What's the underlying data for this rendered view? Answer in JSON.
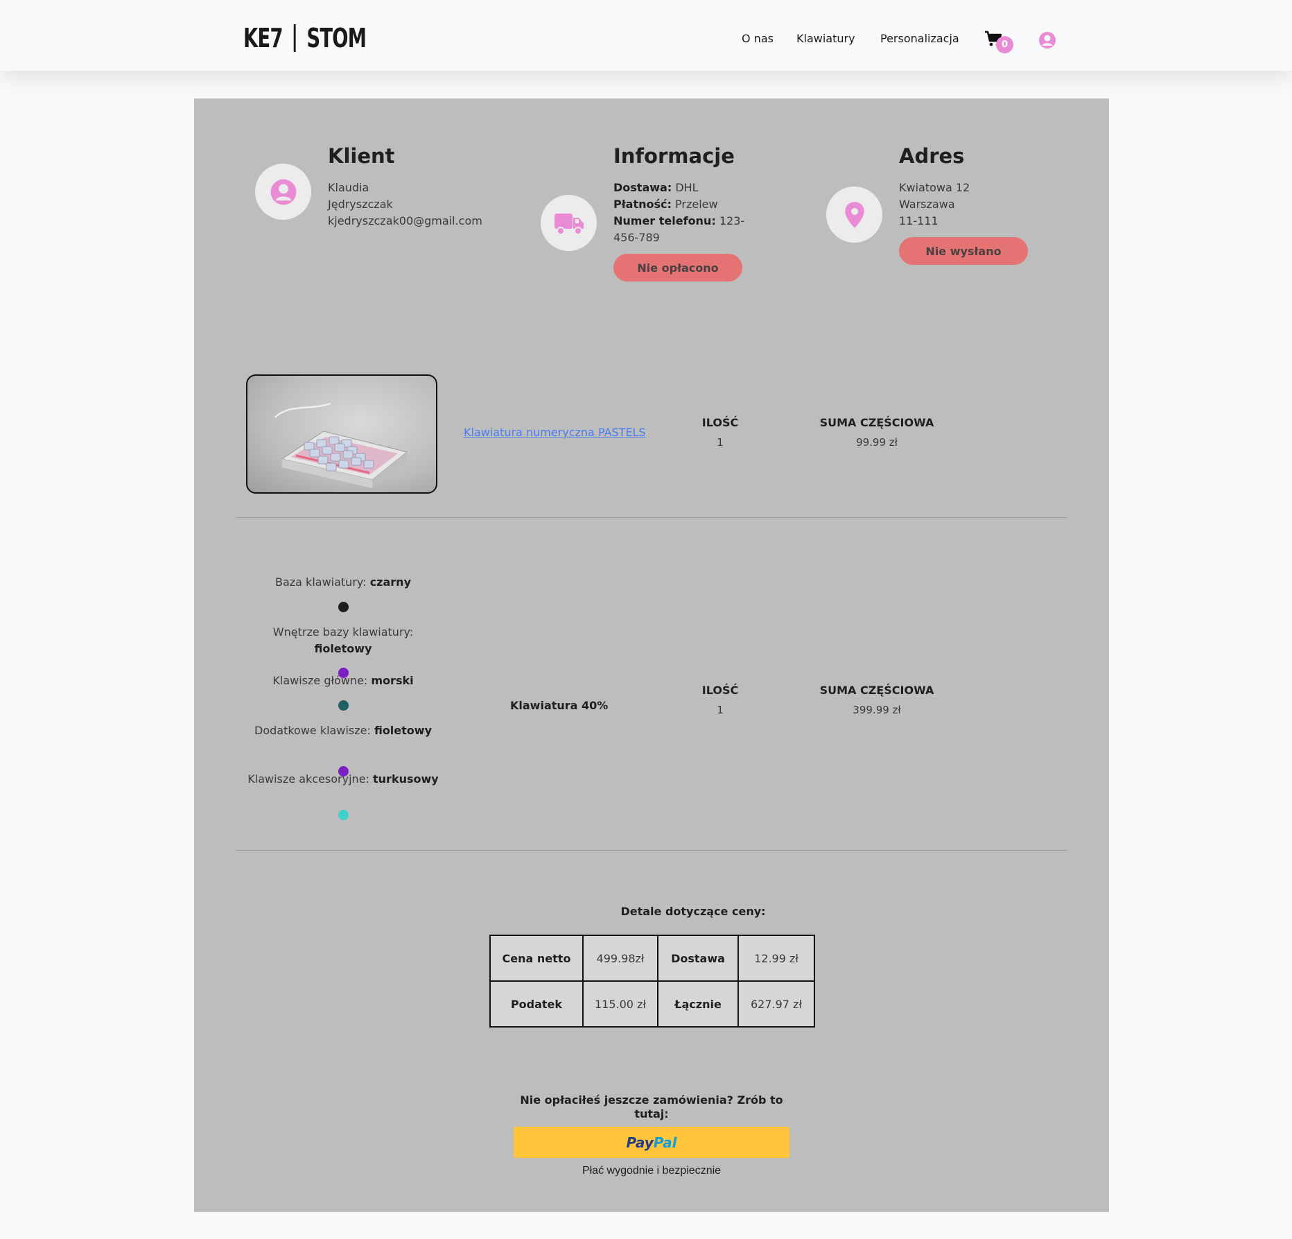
{
  "header": {
    "logo_left": "KE7",
    "logo_right": "STOM",
    "nav": [
      "O nas",
      "Klawiatury",
      "Personalizacja"
    ],
    "cart_count": "0"
  },
  "client": {
    "title": "Klient",
    "first_name": "Klaudia",
    "last_name": "Jędryszczak",
    "email": "kjedryszczak00@gmail.com"
  },
  "info": {
    "title": "Informacje",
    "delivery_label": "Dostawa:",
    "delivery_value": "DHL",
    "payment_label": "Płatność:",
    "payment_value": "Przelew",
    "phone_label": "Numer telefonu:",
    "phone_value_1": "123-",
    "phone_value_2": "456-789",
    "status": "Nie opłacono"
  },
  "address": {
    "title": "Adres",
    "street": "Kwiatowa 12",
    "city": "Warszawa",
    "postal": "11-111",
    "status": "Nie wysłano"
  },
  "items": [
    {
      "name": "Klawiatura numeryczna PASTELS",
      "qty_label": "ILOŚĆ",
      "qty": "1",
      "subtotal_label": "SUMA CZĘŚCIOWA",
      "subtotal": "99.99 zł"
    },
    {
      "name": "Klawiatura 40%",
      "qty_label": "ILOŚĆ",
      "qty": "1",
      "subtotal_label": "SUMA CZĘŚCIOWA",
      "subtotal": "399.99 zł",
      "options": [
        {
          "label": "Baza klawiatury:",
          "value": "czarny",
          "color": "#1e1e1e"
        },
        {
          "label": "Wnętrze bazy klawiatury:",
          "value": "fioletowy",
          "color": "#7b1fc2"
        },
        {
          "label": "Klawisze główne:",
          "value": "morski",
          "color": "#1f5e63"
        },
        {
          "label": "Dodatkowe klawisze:",
          "value": "fioletowy",
          "color": "#7b1fc2"
        },
        {
          "label": "Klawisze akcesoryjne:",
          "value": "turkusowy",
          "color": "#3dd1c8"
        }
      ]
    }
  ],
  "price": {
    "title": "Detale dotyczące ceny:",
    "net_label": "Cena netto",
    "net_value": "499.98zł",
    "delivery_label": "Dostawa",
    "delivery_value": "12.99 zł",
    "tax_label": "Podatek",
    "tax_value": "115.00 zł",
    "total_label": "Łącznie",
    "total_value": "627.97 zł"
  },
  "payment": {
    "prompt": "Nie opłaciłeś jeszcze zamówienia? Zrób to tutaj:",
    "paypal_1": "Pay",
    "paypal_2": "Pal",
    "subtitle": "Płać wygodnie i bezpiecznie"
  },
  "colors": {
    "accent_pink": "#e98cd5",
    "status_red": "#e57373",
    "panel_gray": "#bdbdbd",
    "paypal_yellow": "#ffc439"
  }
}
